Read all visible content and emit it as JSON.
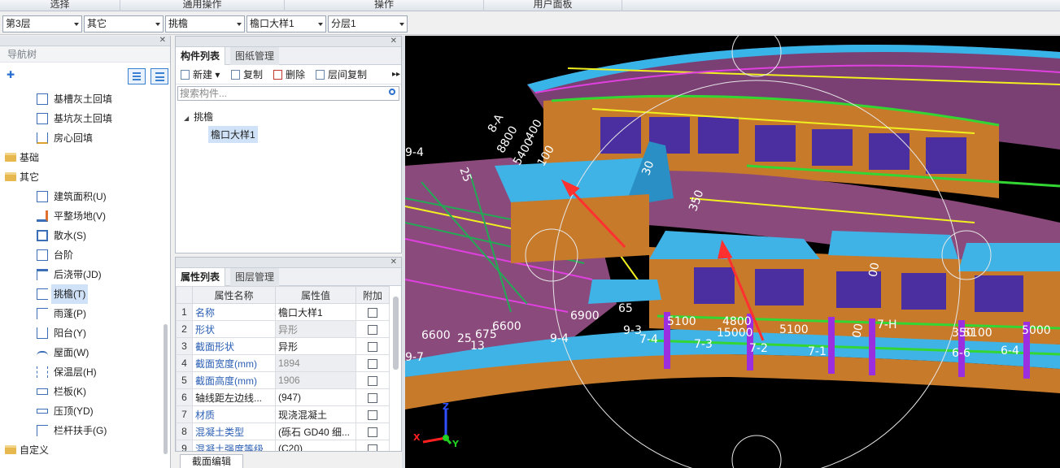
{
  "ribbon": {
    "groups": [
      "选择",
      "通用操作",
      "操作",
      "用户面板"
    ]
  },
  "combos": [
    "第3层",
    "其它",
    "挑檐",
    "檐口大样1",
    "分层1"
  ],
  "nav": {
    "title": "导航树",
    "items": [
      {
        "label": "基槽灰土回填",
        "type": "child"
      },
      {
        "label": "基坑灰土回填",
        "type": "child"
      },
      {
        "label": "房心回填",
        "type": "child"
      },
      {
        "label": "基础",
        "type": "folder"
      },
      {
        "label": "其它",
        "type": "folder"
      },
      {
        "label": "建筑面积(U)",
        "type": "child"
      },
      {
        "label": "平整场地(V)",
        "type": "child"
      },
      {
        "label": "散水(S)",
        "type": "child"
      },
      {
        "label": "台阶",
        "type": "child"
      },
      {
        "label": "后浇带(JD)",
        "type": "child"
      },
      {
        "label": "挑檐(T)",
        "type": "child",
        "selected": true
      },
      {
        "label": "雨蓬(P)",
        "type": "child"
      },
      {
        "label": "阳台(Y)",
        "type": "child"
      },
      {
        "label": "屋面(W)",
        "type": "child"
      },
      {
        "label": "保温层(H)",
        "type": "child"
      },
      {
        "label": "栏板(K)",
        "type": "child"
      },
      {
        "label": "压顶(YD)",
        "type": "child"
      },
      {
        "label": "栏杆扶手(G)",
        "type": "child"
      },
      {
        "label": "自定义",
        "type": "folder"
      }
    ]
  },
  "component_panel": {
    "tabs": [
      "构件列表",
      "图纸管理"
    ],
    "toolbar": {
      "new": "新建",
      "copy": "复制",
      "delete": "删除",
      "floor_copy": "层间复制"
    },
    "search_placeholder": "搜索构件...",
    "tree_group": "挑檐",
    "tree_item": "檐口大样1"
  },
  "property_panel": {
    "tabs": [
      "属性列表",
      "图层管理"
    ],
    "columns": [
      "属性名称",
      "属性值",
      "附加"
    ],
    "rows": [
      {
        "n": "1",
        "name": "名称",
        "value": "檐口大样1",
        "blue": true,
        "gray": false
      },
      {
        "n": "2",
        "name": "形状",
        "value": "异形",
        "blue": true,
        "gray": true
      },
      {
        "n": "3",
        "name": "截面形状",
        "value": "异形",
        "blue": true,
        "gray": false
      },
      {
        "n": "4",
        "name": "截面宽度(mm)",
        "value": "1894",
        "blue": true,
        "gray": true
      },
      {
        "n": "5",
        "name": "截面高度(mm)",
        "value": "1906",
        "blue": true,
        "gray": true
      },
      {
        "n": "6",
        "name": "轴线距左边线...",
        "value": "(947)",
        "blue": false,
        "gray": false
      },
      {
        "n": "7",
        "name": "材质",
        "value": "现浇混凝土",
        "blue": true,
        "gray": false
      },
      {
        "n": "8",
        "name": "混凝土类型",
        "value": "(砾石 GD40 细...",
        "blue": true,
        "gray": false
      },
      {
        "n": "9",
        "name": "混凝土强度等级",
        "value": "(C20)",
        "blue": true,
        "gray": false
      }
    ],
    "bottom_tab": "截面编辑"
  },
  "viewport": {
    "labels": [
      "9-4",
      "8-A",
      "8800",
      "400",
      "5400",
      "100",
      "25",
      "30",
      "350",
      "00",
      "6900",
      "6600",
      "6600",
      "25",
      "675",
      "9-3",
      "9-4",
      "9-7",
      "65",
      "5100",
      "4800",
      "15000",
      "5100",
      "7-4",
      "7-3",
      "7-2",
      "7-1",
      "7-H",
      "00",
      "350",
      "5100",
      "5000",
      "6-6",
      "6-4",
      "13"
    ],
    "axis": {
      "x": "X",
      "y": "Y",
      "z": "Z"
    }
  }
}
